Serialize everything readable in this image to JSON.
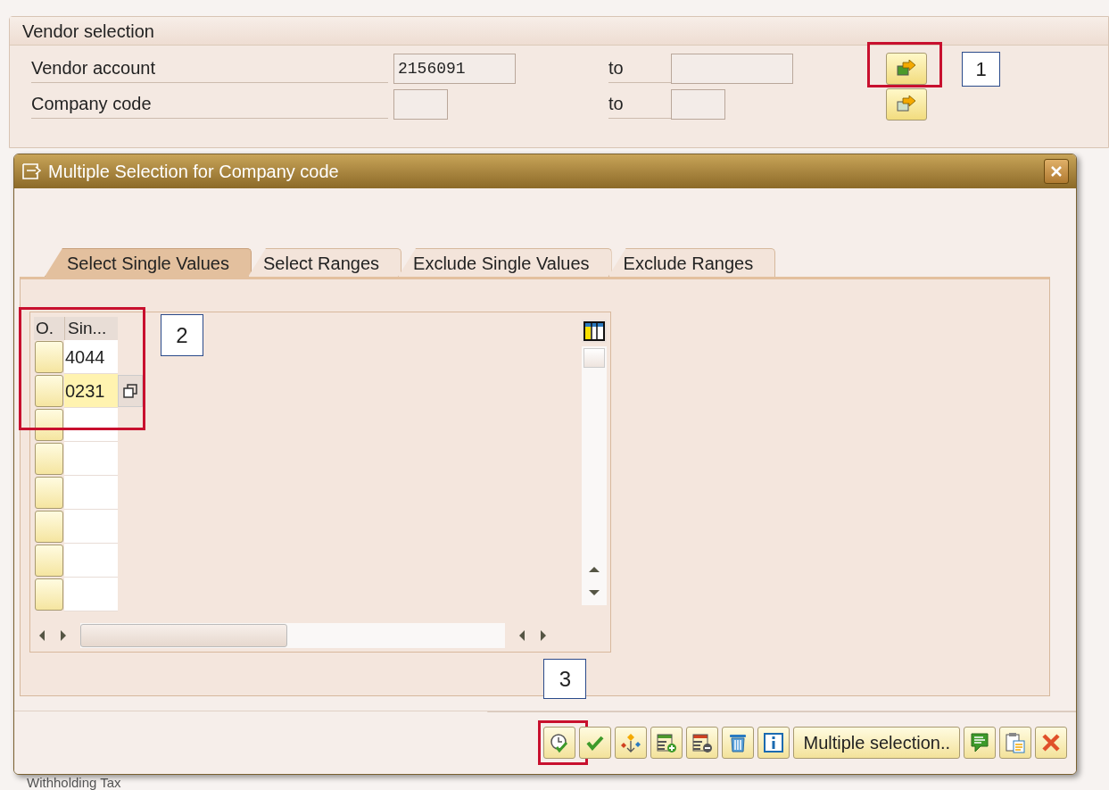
{
  "vendor_selection": {
    "title": "Vendor selection",
    "rows": [
      {
        "label": "Vendor account",
        "from": "2156091",
        "to_label": "to",
        "highlighted": true
      },
      {
        "label": "Company code",
        "to_label": "to"
      }
    ]
  },
  "dialog": {
    "title": "Multiple Selection for Company code",
    "tabs": [
      {
        "label": "Select Single Values",
        "selected": true
      },
      {
        "label": "Select Ranges",
        "selected": false
      },
      {
        "label": "Exclude Single Values",
        "selected": false
      },
      {
        "label": "Exclude Ranges",
        "selected": false
      }
    ],
    "table": {
      "highlighted": true,
      "columns": [
        "O.",
        "Sin..."
      ],
      "rows": [
        {
          "value": "4044",
          "selected": false
        },
        {
          "value": "0231",
          "selected": true
        },
        {
          "selected": false
        },
        {
          "selected": false
        },
        {
          "selected": false
        },
        {
          "selected": false
        },
        {
          "selected": false
        },
        {
          "selected": false
        }
      ]
    },
    "toolbar": [
      {
        "kind": "execute",
        "highlighted": true
      },
      {
        "kind": "check"
      },
      {
        "kind": "wizard"
      },
      {
        "kind": "insert-row"
      },
      {
        "kind": "delete-row"
      },
      {
        "kind": "trash"
      },
      {
        "kind": "info"
      },
      {
        "kind": "text",
        "label": "Multiple selection.."
      },
      {
        "kind": "comment"
      },
      {
        "kind": "clipboard"
      },
      {
        "kind": "cancel"
      }
    ]
  },
  "annotations": [
    {
      "label": "1"
    },
    {
      "label": "2"
    },
    {
      "label": "3"
    }
  ],
  "background_text": "Withholding Tax"
}
